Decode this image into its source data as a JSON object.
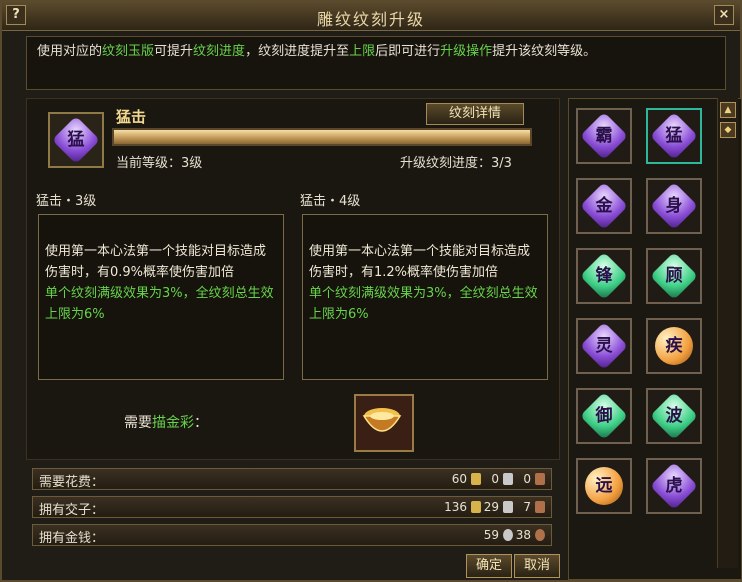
{
  "window": {
    "title": "雕纹纹刻升级",
    "help_label": "?",
    "close_label": "×"
  },
  "description": {
    "part1": "使用对应的",
    "hl1": "纹刻玉版",
    "part2": "可提升",
    "hl2": "纹刻进度",
    "part3": "，纹刻进度提升至",
    "hl3": "上限",
    "part4": "后即可进行",
    "hl4": "升级操作",
    "part5": "提升该纹刻等级。"
  },
  "skill": {
    "name": "猛击",
    "icon_glyph": "猛",
    "detail_button": "纹刻详情",
    "current_level_label": "当前等级：3级",
    "progress_label": "升级纹刻进度：3/3",
    "progress_fraction": 1.0
  },
  "current_effect": {
    "title": "猛击・3级",
    "text": "使用第一本心法第一个技能对目标造成伤害时，有0.9%概率使伤害加倍",
    "note": "单个纹刻满级效果为3%，全纹刻总生效上限为6%"
  },
  "next_effect": {
    "title": "猛击・4级",
    "text": "使用第一本心法第一个技能对目标造成伤害时，有1.2%概率使伤害加倍",
    "note": "单个纹刻满级效果为3%，全纹刻总生效上限为6%"
  },
  "material": {
    "label_prefix": "需要",
    "label_item": "描金彩",
    "label_suffix": "："
  },
  "costs": [
    {
      "label": "需要花费：",
      "values": [
        "60",
        "0",
        "0"
      ]
    },
    {
      "label": "拥有交子：",
      "values": [
        "136",
        "29",
        "7"
      ]
    },
    {
      "label": "拥有金钱：",
      "values": [
        "59",
        "38"
      ]
    }
  ],
  "colors": {
    "gold_coin": "#d8b24a",
    "silver_coin": "#c9c9c9",
    "copper_coin": "#b0704a",
    "highlight_green": "#67d34c",
    "selected_border": "#2fb79a"
  },
  "grid": [
    {
      "glyph": "霸",
      "color": "purple",
      "selected": false
    },
    {
      "glyph": "猛",
      "color": "purple",
      "selected": true
    },
    {
      "glyph": "金",
      "color": "purple",
      "selected": false
    },
    {
      "glyph": "身",
      "color": "purple",
      "selected": false
    },
    {
      "glyph": "锋",
      "color": "green",
      "selected": false
    },
    {
      "glyph": "顾",
      "color": "green",
      "selected": false
    },
    {
      "glyph": "灵",
      "color": "purple",
      "selected": false
    },
    {
      "glyph": "疾",
      "color": "orange",
      "selected": false
    },
    {
      "glyph": "御",
      "color": "green",
      "selected": false
    },
    {
      "glyph": "波",
      "color": "green",
      "selected": false
    },
    {
      "glyph": "远",
      "color": "orange",
      "selected": false
    },
    {
      "glyph": "虎",
      "color": "purple",
      "selected": false
    }
  ],
  "buttons": {
    "confirm": "确定",
    "cancel": "取消"
  }
}
